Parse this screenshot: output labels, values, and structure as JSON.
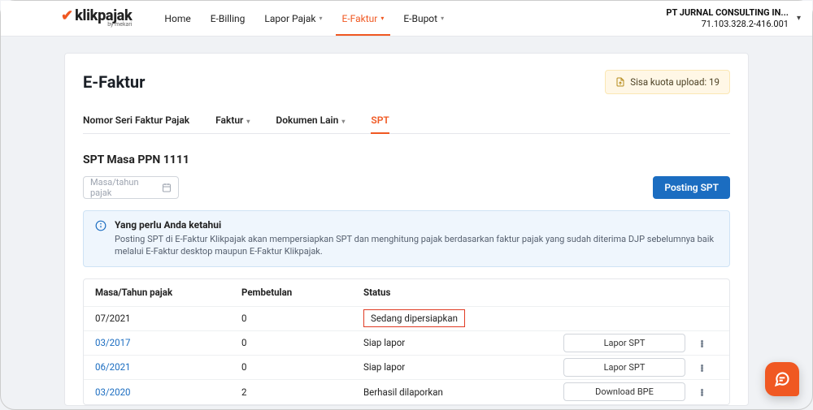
{
  "brand": {
    "name": "klikpajak",
    "by": "by mekari"
  },
  "nav": {
    "items": [
      {
        "label": "Home",
        "dropdown": false,
        "active": false
      },
      {
        "label": "E-Billing",
        "dropdown": false,
        "active": false
      },
      {
        "label": "Lapor Pajak",
        "dropdown": true,
        "active": false
      },
      {
        "label": "E-Faktur",
        "dropdown": true,
        "active": true
      },
      {
        "label": "E-Bupot",
        "dropdown": true,
        "active": false
      }
    ]
  },
  "company": {
    "name": "PT JURNAL CONSULTING IN...",
    "id": "71.103.328.2-416.001"
  },
  "page": {
    "title": "E-Faktur",
    "quota_label": "Sisa kuota upload: 19",
    "tabs": [
      {
        "label": "Nomor Seri Faktur Pajak",
        "dropdown": false,
        "active": false
      },
      {
        "label": "Faktur",
        "dropdown": true,
        "active": false
      },
      {
        "label": "Dokumen Lain",
        "dropdown": true,
        "active": false
      },
      {
        "label": "SPT",
        "dropdown": false,
        "active": true
      }
    ],
    "section_title": "SPT Masa PPN 1111",
    "date_placeholder": "Masa/tahun pajak",
    "posting_btn": "Posting SPT",
    "info": {
      "title": "Yang perlu Anda ketahui",
      "body": "Posting SPT di E-Faktur Klikpajak akan mempersiapkan SPT dan menghitung pajak berdasarkan faktur pajak yang sudah diterima DJP sebelumnya baik melalui E-Faktur desktop maupun E-Faktur Klikpajak."
    },
    "table": {
      "headers": {
        "period": "Masa/Tahun pajak",
        "pembetulan": "Pembetulan",
        "status": "Status"
      },
      "rows": [
        {
          "period": "07/2021",
          "link": false,
          "pembetulan": "0",
          "status": "Sedang dipersiapkan",
          "highlight": true,
          "action": null
        },
        {
          "period": "03/2017",
          "link": true,
          "pembetulan": "0",
          "status": "Siap lapor",
          "highlight": false,
          "action": "Lapor SPT"
        },
        {
          "period": "06/2021",
          "link": true,
          "pembetulan": "0",
          "status": "Siap lapor",
          "highlight": false,
          "action": "Lapor SPT"
        },
        {
          "period": "03/2020",
          "link": true,
          "pembetulan": "2",
          "status": "Berhasil dilaporkan",
          "highlight": false,
          "action": "Download BPE"
        }
      ]
    }
  }
}
